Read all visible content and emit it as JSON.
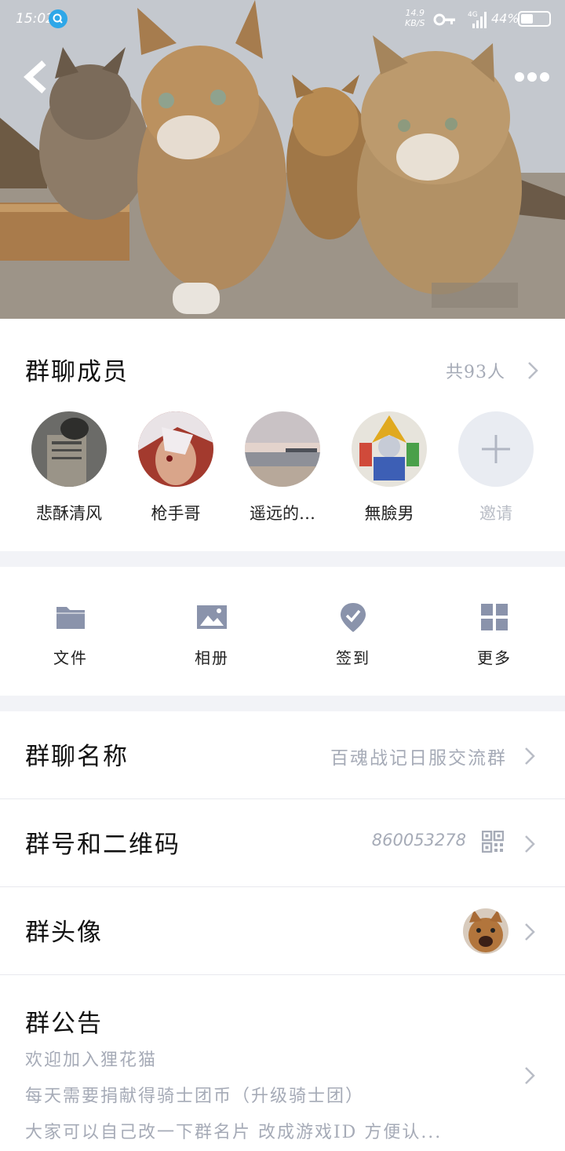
{
  "status_bar": {
    "time": "15:02",
    "net_speed_value": "14.9",
    "net_speed_unit": "KB/S",
    "network": "4G",
    "battery_text": "44%",
    "battery_level": 0.44
  },
  "members": {
    "title": "群聊成员",
    "count": "共93人",
    "list": [
      {
        "name": "悲酥清风"
      },
      {
        "name": "枪手哥"
      },
      {
        "name": "遥远的…"
      },
      {
        "name": "無臉男"
      }
    ],
    "invite_label": "邀请"
  },
  "actions": [
    {
      "label": "文件",
      "icon": "folder-icon"
    },
    {
      "label": "相册",
      "icon": "image-icon"
    },
    {
      "label": "签到",
      "icon": "checkin-icon"
    },
    {
      "label": "更多",
      "icon": "grid-icon"
    }
  ],
  "rows": {
    "group_name": {
      "label": "群聊名称",
      "value": "百魂战记日服交流群"
    },
    "group_id": {
      "label": "群号和二维码",
      "value": "860053278"
    },
    "group_avatar": {
      "label": "群头像"
    },
    "notice": {
      "label": "群公告",
      "lines": [
        "欢迎加入狸花猫",
        "每天需要捐献得骑士团币（升级骑士团）",
        "大家可以自己改一下群名片 改成游戏ID 方便认..."
      ]
    }
  },
  "colors": {
    "accent_icon": "#8a93ab",
    "secondary_text": "#a6abb7",
    "separator": "#f2f3f7"
  }
}
